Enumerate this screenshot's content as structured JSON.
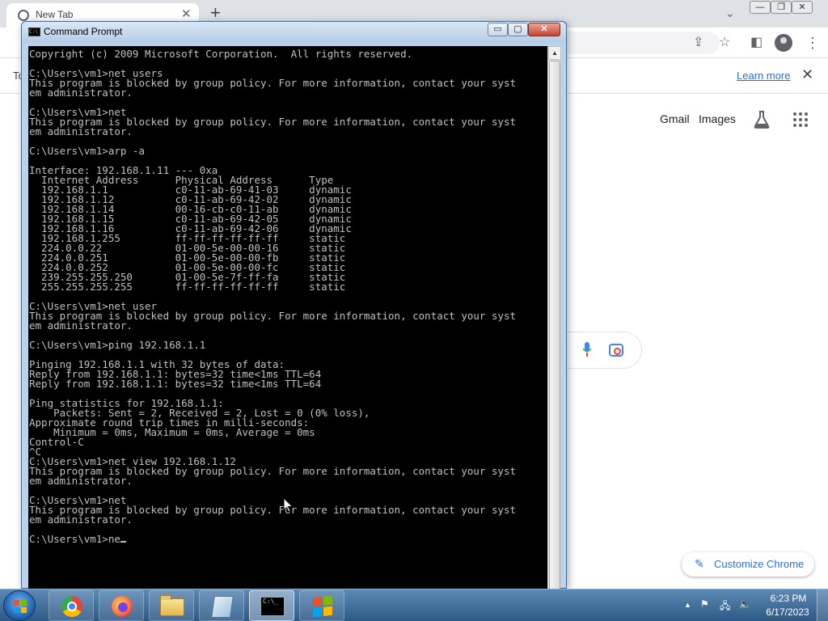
{
  "chrome": {
    "tab_title": "New Tab",
    "tab_close": "✕",
    "new_tab": "+",
    "tab_search": "⌄",
    "window_controls": [
      "—",
      "❐",
      "✕"
    ],
    "toolbar_icons": [
      "share-icon",
      "star-icon",
      "side-panel-icon",
      "profile-icon",
      "menu-icon"
    ],
    "infobar_text": "To",
    "learn_more": "Learn more",
    "infobar_close": "✕",
    "header_links": [
      "Gmail",
      "Images"
    ],
    "customize_label": "Customize Chrome",
    "colors": {
      "tabstrip": "#dee1e6",
      "link": "#1a73e8"
    }
  },
  "cmd": {
    "title": "Command Prompt",
    "icon_text": "C:\\",
    "controls": [
      "▭",
      "▢",
      "✕"
    ],
    "lines": [
      "Copyright (c) 2009 Microsoft Corporation.  All rights reserved.",
      "",
      "C:\\Users\\vm1>net users",
      "This program is blocked by group policy. For more information, contact your syst",
      "em administrator.",
      "",
      "C:\\Users\\vm1>net",
      "This program is blocked by group policy. For more information, contact your syst",
      "em administrator.",
      "",
      "C:\\Users\\vm1>arp -a",
      "",
      "Interface: 192.168.1.11 --- 0xa",
      "  Internet Address      Physical Address      Type",
      "  192.168.1.1           c0-11-ab-69-41-03     dynamic",
      "  192.168.1.12          c0-11-ab-69-42-02     dynamic",
      "  192.168.1.14          00-16-cb-c0-11-ab     dynamic",
      "  192.168.1.15          c0-11-ab-69-42-05     dynamic",
      "  192.168.1.16          c0-11-ab-69-42-06     dynamic",
      "  192.168.1.255         ff-ff-ff-ff-ff-ff     static",
      "  224.0.0.22            01-00-5e-00-00-16     static",
      "  224.0.0.251           01-00-5e-00-00-fb     static",
      "  224.0.0.252           01-00-5e-00-00-fc     static",
      "  239.255.255.250       01-00-5e-7f-ff-fa     static",
      "  255.255.255.255       ff-ff-ff-ff-ff-ff     static",
      "",
      "C:\\Users\\vm1>net user",
      "This program is blocked by group policy. For more information, contact your syst",
      "em administrator.",
      "",
      "C:\\Users\\vm1>ping 192.168.1.1",
      "",
      "Pinging 192.168.1.1 with 32 bytes of data:",
      "Reply from 192.168.1.1: bytes=32 time<1ms TTL=64",
      "Reply from 192.168.1.1: bytes=32 time<1ms TTL=64",
      "",
      "Ping statistics for 192.168.1.1:",
      "    Packets: Sent = 2, Received = 2, Lost = 0 (0% loss),",
      "Approximate round trip times in milli-seconds:",
      "    Minimum = 0ms, Maximum = 0ms, Average = 0ms",
      "Control-C",
      "^C",
      "C:\\Users\\vm1>net view 192.168.1.12",
      "This program is blocked by group policy. For more information, contact your syst",
      "em administrator.",
      "",
      "C:\\Users\\vm1>net",
      "This program is blocked by group policy. For more information, contact your syst",
      "em administrator.",
      "",
      "C:\\Users\\vm1>ne"
    ],
    "colors": {
      "background": "#000000",
      "text": "#c0c0c0"
    }
  },
  "taskbar": {
    "apps": [
      "chrome",
      "firefox",
      "windows-explorer",
      "notepad",
      "command-prompt",
      "windows-flag"
    ],
    "cmd_icon_text": "C:\\_",
    "tray_arrow": "▲",
    "tray_icons": [
      "action-center-icon",
      "network-icon",
      "volume-icon"
    ],
    "time": "6:23 PM",
    "date": "6/17/2023"
  }
}
